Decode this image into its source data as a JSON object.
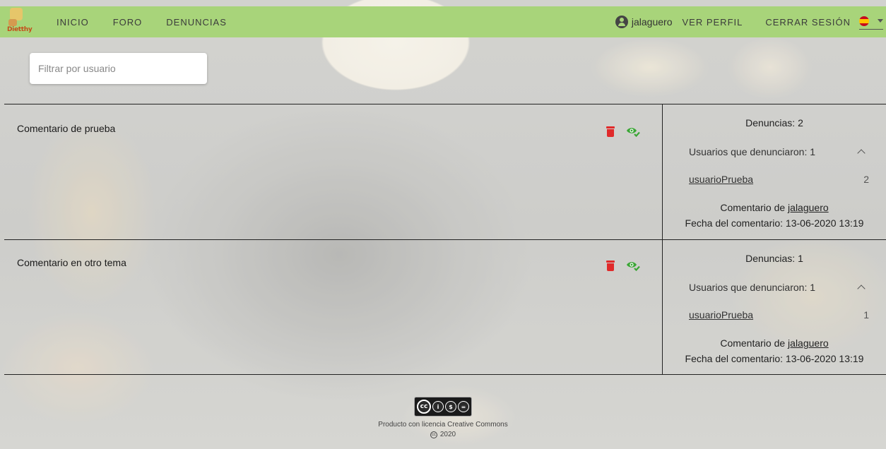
{
  "navbar": {
    "logo_text": "Dietthy",
    "links": [
      "INICIO",
      "FORO",
      "DENUNCIAS"
    ],
    "username": "jalaguero",
    "profile_label": "VER PERFIL",
    "logout_label": "CERRAR SESIÓN",
    "language_flag": "spain-flag-icon",
    "bg_color": "#a8d47a"
  },
  "filter": {
    "placeholder": "Filtrar por usuario",
    "value": ""
  },
  "reports": [
    {
      "comment": "Comentario de prueba",
      "count_label": "Denuncias: 2",
      "users_label": "Usuarios que denunciaron: 1",
      "users": [
        {
          "name": "usuarioPrueba",
          "count": "2"
        }
      ],
      "author_prefix": "Comentario de ",
      "author": "jalaguero",
      "date_label": "Fecha del comentario: 13-06-2020 13:19"
    },
    {
      "comment": "Comentario en otro tema",
      "count_label": "Denuncias: 1",
      "users_label": "Usuarios que denunciaron: 1",
      "users": [
        {
          "name": "usuarioPrueba",
          "count": "1"
        }
      ],
      "author_prefix": "Comentario de ",
      "author": "jalaguero",
      "date_label": "Fecha del comentario: 13-06-2020 13:19"
    }
  ],
  "colors": {
    "delete": "#e02a2a",
    "approve": "#3aa635"
  },
  "footer": {
    "badge_text": "BY NC ND",
    "license_text": "Producto con licencia Creative Commons",
    "year": "2020"
  }
}
